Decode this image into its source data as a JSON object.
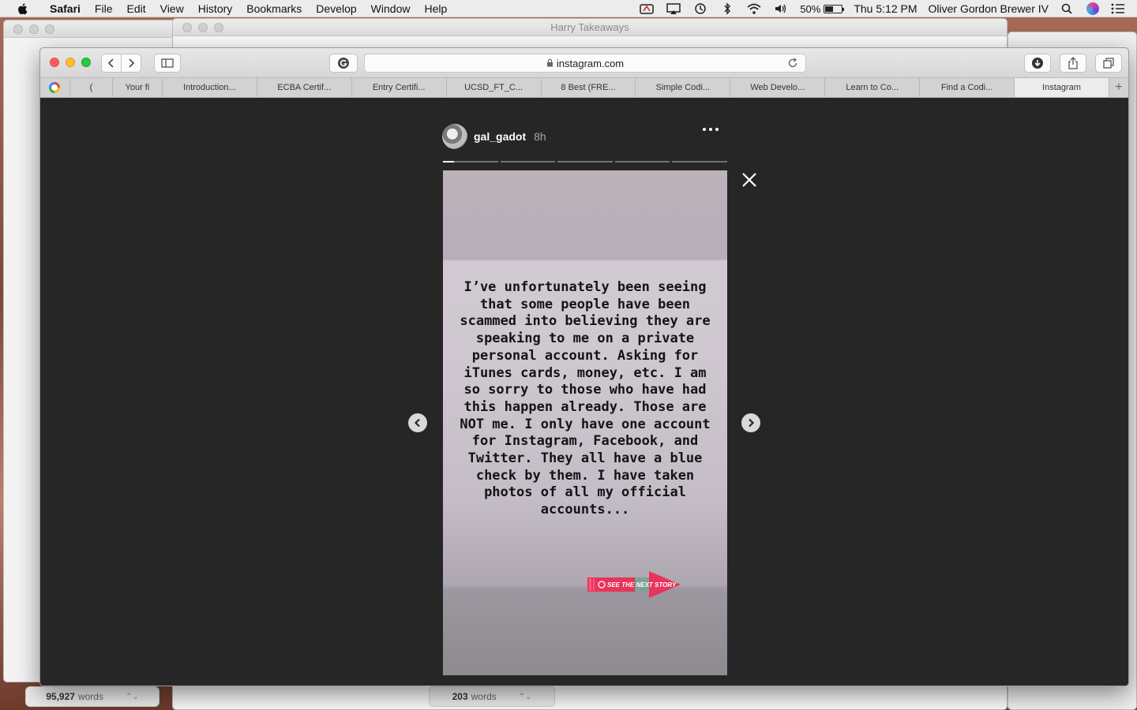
{
  "menubar": {
    "app": "Safari",
    "items": [
      "File",
      "Edit",
      "View",
      "History",
      "Bookmarks",
      "Develop",
      "Window",
      "Help"
    ],
    "battery_pct": "50%",
    "battery_level": 0.5,
    "clock": "Thu 5:12 PM",
    "user": "Oliver Gordon Brewer IV"
  },
  "background": {
    "doc_title": "Harry Takeaways",
    "left_word_count": "95,927",
    "left_word_unit": "words",
    "mid_word_count": "203",
    "mid_word_unit": "words"
  },
  "browser": {
    "url": "instagram.com",
    "tabs": [
      {
        "label": "",
        "icon": "google-icon"
      },
      {
        "label": "("
      },
      {
        "label": "Your fi"
      },
      {
        "label": "Introduction..."
      },
      {
        "label": "ECBA Certif..."
      },
      {
        "label": "Entry Certifi..."
      },
      {
        "label": "UCSD_FT_C..."
      },
      {
        "label": "8 Best (FRE..."
      },
      {
        "label": "Simple Codi..."
      },
      {
        "label": "Web Develo..."
      },
      {
        "label": "Learn to Co..."
      },
      {
        "label": "Find a Codi..."
      },
      {
        "label": "Instagram",
        "active": true
      }
    ],
    "new_tab_label": "+"
  },
  "story": {
    "username": "gal_gadot",
    "time_ago": "8h",
    "segments": 5,
    "current_segment_progress": 0.2,
    "text": "I’ve unfortunately been seeing that some people have been scammed into believing they are speaking to me on a private personal account. Asking for iTunes cards, money, etc. I am so sorry to those who have had this happen already. Those are NOT me. I only have one account for Instagram, Facebook, and Twitter. They all have a blue check by them. I have taken photos of all my official accounts...",
    "sticker_text": "SEE THE NEXT STORY"
  },
  "colors": {
    "story_bg": "#262626",
    "sticker_pink": "#e8335a",
    "sticker_teal": "#4fd1b0"
  }
}
